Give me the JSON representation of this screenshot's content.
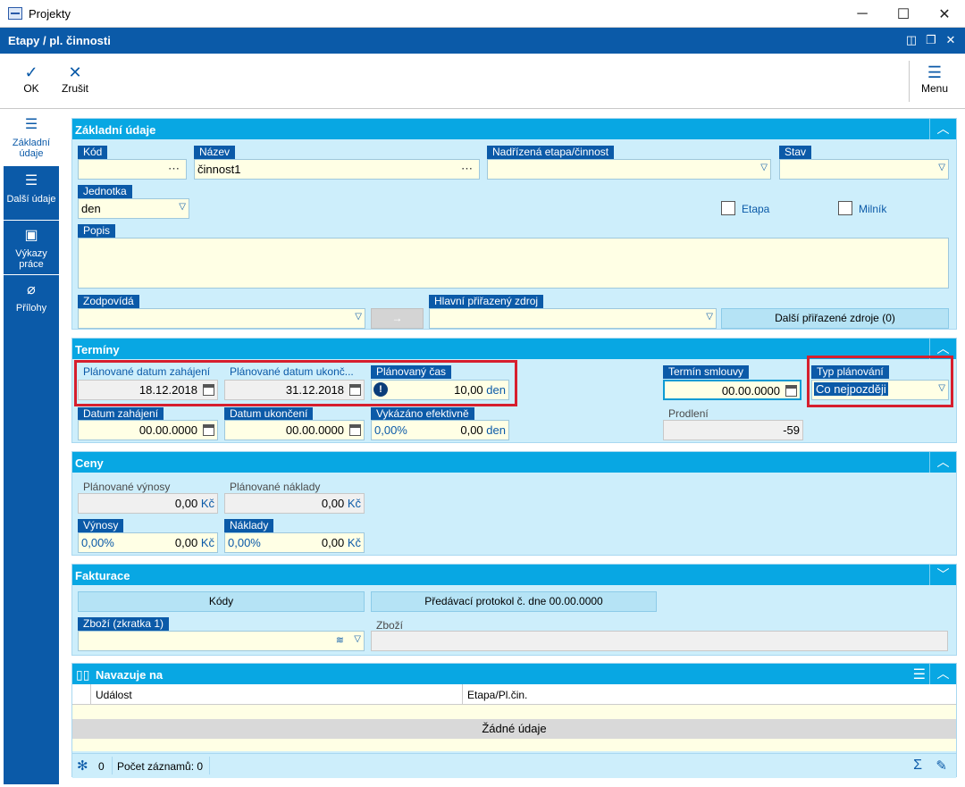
{
  "window": {
    "title": "Projekty",
    "minimize": "─",
    "maximize": "☐",
    "close": "✕"
  },
  "subwindow": {
    "title": "Etapy / pl. činnosti"
  },
  "toolbar": {
    "ok": "OK",
    "cancel": "Zrušit",
    "menu": "Menu"
  },
  "sidebar": {
    "items": [
      {
        "label": "Základní údaje",
        "icon": "list-icon"
      },
      {
        "label": "Další údaje",
        "icon": "list-icon"
      },
      {
        "label": "Výkazy práce",
        "icon": "archive-box-icon"
      },
      {
        "label": "Přílohy",
        "icon": "paperclip-icon"
      }
    ]
  },
  "basic": {
    "title": "Základní údaje",
    "kod_label": "Kód",
    "kod_value": "",
    "nazev_label": "Název",
    "nazev_value": "činnost1",
    "nadrizena_label": "Nadřízená etapa/činnost",
    "nadrizena_value": "",
    "stav_label": "Stav",
    "stav_value": "",
    "jednotka_label": "Jednotka",
    "jednotka_value": "den",
    "etapa_label": "Etapa",
    "milnik_label": "Milník",
    "popis_label": "Popis",
    "popis_value": "",
    "zodpovida_label": "Zodpovídá",
    "zodpovida_value": "",
    "arrow": "→",
    "hlavni_zdroj_label": "Hlavní přiřazený zdroj",
    "hlavni_zdroj_value": "",
    "dalsi_zdroje_button": "Další přiřazené zdroje (0)"
  },
  "terminy": {
    "title": "Termíny",
    "plan_start_label": "Plánované datum zahájení",
    "plan_start_value": "18.12.2018",
    "plan_end_label": "Plánované datum ukonč...",
    "plan_end_value": "31.12.2018",
    "plan_cas_label": "Plánovaný čas",
    "plan_cas_value": "10,00",
    "plan_cas_unit": "den",
    "smlouva_label": "Termín smlouvy",
    "smlouva_value": "00.00.0000",
    "typ_label": "Typ plánování",
    "typ_value": "Co nejpozději",
    "start_label": "Datum zahájení",
    "start_value": "00.00.0000",
    "end_label": "Datum ukončení",
    "end_value": "00.00.0000",
    "vykazano_label": "Vykázáno efektivně",
    "vykazano_pct": "0,00%",
    "vykazano_value": "0,00",
    "vykazano_unit": "den",
    "prodleni_label": "Prodlení",
    "prodleni_value": "-59"
  },
  "ceny": {
    "title": "Ceny",
    "plan_vynosy_label": "Plánované výnosy",
    "plan_vynosy_value": "0,00",
    "plan_naklady_label": "Plánované náklady",
    "plan_naklady_value": "0,00",
    "vynosy_label": "Výnosy",
    "vynosy_pct": "0,00%",
    "vynosy_value": "0,00",
    "naklady_label": "Náklady",
    "naklady_pct": "0,00%",
    "naklady_value": "0,00",
    "currency": "Kč"
  },
  "fakturace": {
    "title": "Fakturace",
    "kody_button": "Kódy",
    "protokol_button": "Předávací protokol č.  dne 00.00.0000",
    "zbozi_zkratka_label": "Zboží (zkratka 1)",
    "zbozi_zkratka_value": "",
    "zbozi_label": "Zboží",
    "zbozi_value": ""
  },
  "navazuje": {
    "title": "Navazuje na",
    "columns": [
      "Událost",
      "Etapa/Pl.čin."
    ],
    "empty": "Žádné údaje",
    "filter_count": "0",
    "record_count": "Počet záznamů: 0"
  },
  "colors": {
    "header": "#0b5aa8",
    "section": "#08a7e3",
    "highlight": "#d61f2e"
  }
}
